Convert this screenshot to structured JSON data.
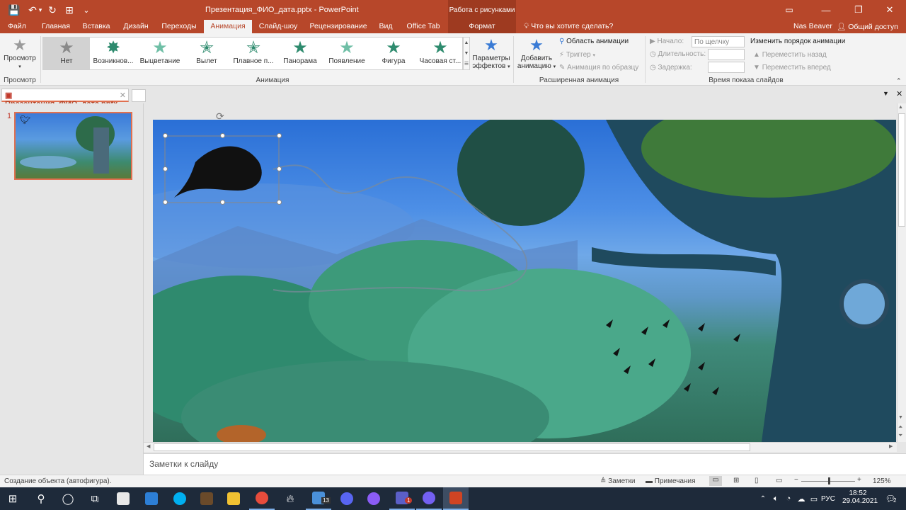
{
  "window": {
    "title": "Презентация_ФИО_дата.pptx - PowerPoint",
    "contextual_group": "Работа с рисунками",
    "minimize": "—",
    "restore": "❐",
    "close": "✕"
  },
  "quick_access": {
    "save": "💾",
    "undo": "↶",
    "undo_more": "▾",
    "redo": "↻",
    "touch": "⊞",
    "more": "⌄"
  },
  "tabs": [
    "Файл",
    "Главная",
    "Вставка",
    "Дизайн",
    "Переходы",
    "Анимация",
    "Слайд-шоу",
    "Рецензирование",
    "Вид",
    "Office Tab",
    "Формат"
  ],
  "active_tab": "Анимация",
  "tell_me": "Что вы хотите сделать?",
  "user": "Nas Beaver",
  "share": "Общий доступ",
  "ribbon": {
    "preview_label": "Просмотр",
    "preview_group": "Просмотр",
    "animation_group": "Анимация",
    "gallery": [
      "Нет",
      "Возникнов...",
      "Выцветание",
      "Вылет",
      "Плавное п...",
      "Панорама",
      "Появление",
      "Фигура",
      "Часовая ст..."
    ],
    "gallery_selected": "Нет",
    "effect_options": "Параметры эффектов",
    "add_animation": "Добавить анимацию",
    "animation_pane": "Область анимации",
    "trigger": "Триггер",
    "anim_painter": "Анимация по образцу",
    "advanced_group": "Расширенная анимация",
    "start_label": "Начало:",
    "start_value": "По щелчку",
    "duration_label": "Длительность:",
    "delay_label": "Задержка:",
    "reorder_title": "Изменить порядок анимации",
    "move_earlier": "Переместить назад",
    "move_later": "Переместить вперед",
    "timing_group": "Время показа слайдов"
  },
  "doc_tab": "Презентация_ФИО_дата.pptx",
  "slide_number": "1",
  "notes_placeholder": "Заметки к слайду",
  "status": {
    "left": "Создание объекта (автофигура).",
    "notes": "Заметки",
    "comments": "Примечания",
    "zoom": "125%"
  },
  "taskbar": {
    "time": "18:52",
    "date": "29.04.2021",
    "lang": "РУС",
    "teams_badge": "1",
    "explorer_badge": "13",
    "notif_badge": "2"
  },
  "colors": {
    "accent": "#b7472a",
    "taskbar": "#1e2a3a"
  }
}
